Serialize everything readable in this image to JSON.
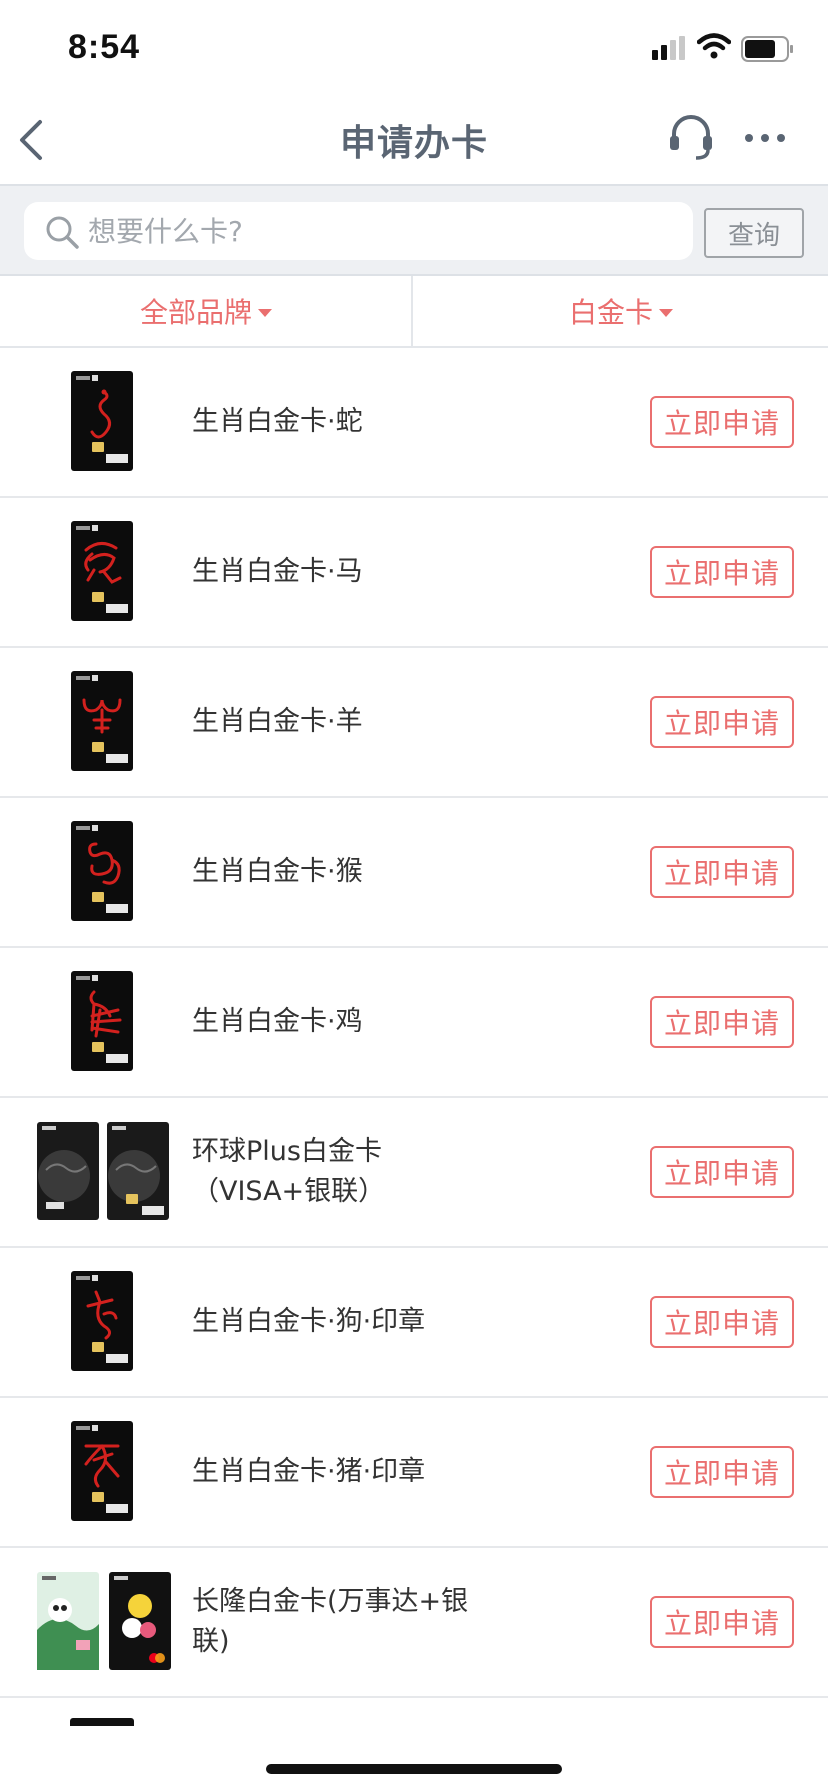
{
  "status_bar": {
    "time": "8:54"
  },
  "nav": {
    "title": "申请办卡"
  },
  "search": {
    "placeholder": "想要什么卡?",
    "button_label": "查询"
  },
  "filters": {
    "brand_label": "全部品牌",
    "level_label": "白金卡"
  },
  "colors": {
    "accent": "#ea6f6f",
    "title": "#5a6573",
    "card_black": "#0c0c0c",
    "zodiac_red": "#d3211e"
  },
  "cards": [
    {
      "name": "生肖白金卡·蛇",
      "apply_label": "立即申请",
      "thumb": "zodiac-snake"
    },
    {
      "name": "生肖白金卡·马",
      "apply_label": "立即申请",
      "thumb": "zodiac-horse"
    },
    {
      "name": "生肖白金卡·羊",
      "apply_label": "立即申请",
      "thumb": "zodiac-goat"
    },
    {
      "name": "生肖白金卡·猴",
      "apply_label": "立即申请",
      "thumb": "zodiac-monkey"
    },
    {
      "name": "生肖白金卡·鸡",
      "apply_label": "立即申请",
      "thumb": "zodiac-rooster"
    },
    {
      "name": "环球Plus白金卡（VISA+银联）",
      "apply_label": "立即申请",
      "thumb": "globe-pair"
    },
    {
      "name": "生肖白金卡·狗·印章",
      "apply_label": "立即申请",
      "thumb": "zodiac-dog"
    },
    {
      "name": "生肖白金卡·猪·印章",
      "apply_label": "立即申请",
      "thumb": "zodiac-pig"
    },
    {
      "name": "长隆白金卡(万事达+银联)",
      "apply_label": "立即申请",
      "thumb": "chimelong-pair"
    }
  ]
}
